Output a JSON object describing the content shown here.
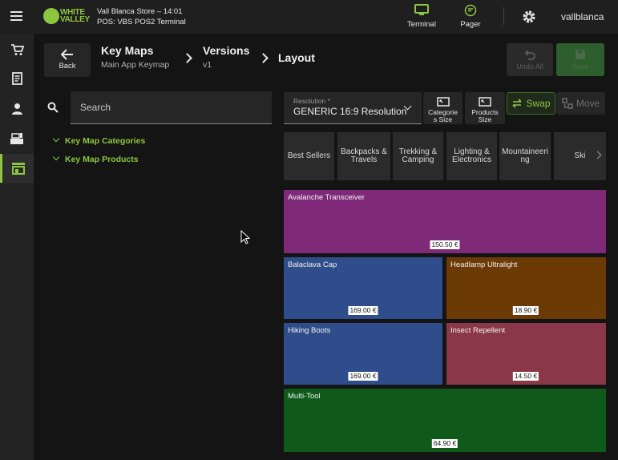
{
  "topbar": {
    "brand_line1": "WHITE",
    "brand_line2": "VALLEY",
    "store_info": "Vall Blanca Store – 14:01",
    "pos_info": "POS: VBS POS2 Terminal",
    "terminal_label": "Terminal",
    "pager_label": "Pager",
    "user_name": "vallblanca"
  },
  "header": {
    "back_label": "Back",
    "crumb1_title": "Key Maps",
    "crumb1_sub": "Main App Keymap",
    "crumb2_title": "Versions",
    "crumb2_sub": "v1",
    "crumb3_title": "Layout",
    "undo_label": "Undo All",
    "save_label": "Save"
  },
  "left_panel": {
    "search_placeholder": "Search",
    "tree": [
      {
        "label": "Key Map Categories"
      },
      {
        "label": "Key Map Products"
      }
    ]
  },
  "toolbar": {
    "resolution_label": "Resolution *",
    "resolution_value": "GENERIC 16:9 Resolution",
    "categories_size_line1": "Categorie",
    "categories_size_line2": "s Size",
    "products_size_line1": "Products",
    "products_size_line2": "Size",
    "swap_label": "Swap",
    "move_label": "Move"
  },
  "categories": [
    {
      "line1": "Best Sellers",
      "line2": ""
    },
    {
      "line1": "Backpacks &",
      "line2": "Travels"
    },
    {
      "line1": "Trekking &",
      "line2": "Camping"
    },
    {
      "line1": "Lighting &",
      "line2": "Electronics"
    },
    {
      "line1": "Mountaineeri",
      "line2": "ng"
    },
    {
      "line1": "Ski",
      "line2": ""
    }
  ],
  "products": [
    {
      "name": "Avalanche Transceiver",
      "price": "150.50 €",
      "color": "#7e2a78"
    },
    {
      "name": "Balaclava Cap",
      "price": "169.00 €",
      "color": "#2f4d8a"
    },
    {
      "name": "Headlamp Ultralight",
      "price": "18.90 €",
      "color": "#6b3a05"
    },
    {
      "name": "Hiking Boots",
      "price": "169.00 €",
      "color": "#2f4d8a"
    },
    {
      "name": "Insect Repellent",
      "price": "14.50 €",
      "color": "#8a3848"
    },
    {
      "name": "Multi-Tool",
      "price": "64.90 €",
      "color": "#0f5a1a"
    }
  ],
  "colors": {
    "accent": "#8dc63f",
    "background": "#141414",
    "panel": "#262626"
  },
  "icons": [
    "menu-icon",
    "cart-icon",
    "receipt-icon",
    "user-icon",
    "cash-register-icon",
    "store-icon",
    "monitor-icon",
    "pager-icon",
    "gear-icon",
    "arrow-left-icon",
    "undo-icon",
    "save-icon",
    "search-icon",
    "resize-icon",
    "swap-icon",
    "move-icon"
  ]
}
